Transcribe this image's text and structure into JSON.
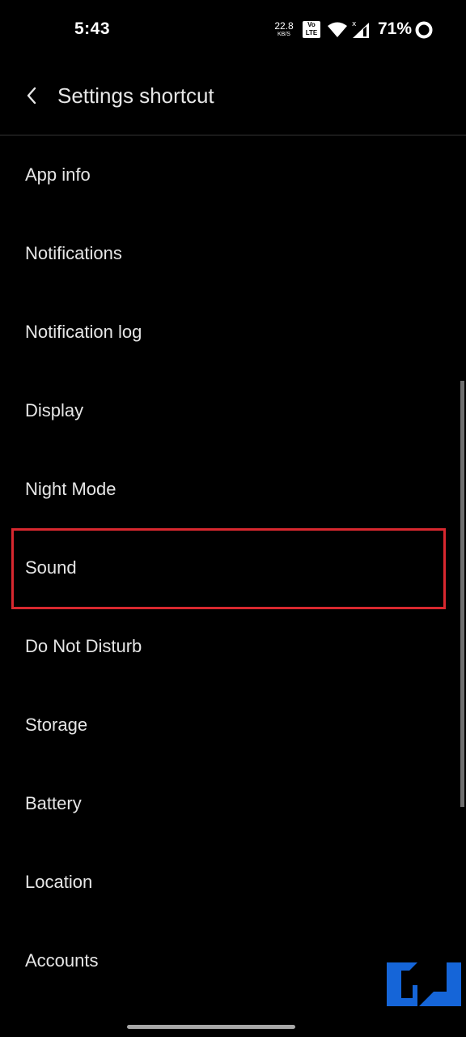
{
  "status_bar": {
    "time": "5:43",
    "net_speed_value": "22.8",
    "net_speed_unit": "KB/S",
    "volte_top": "Vo",
    "volte_bottom": "LTE",
    "battery_percent": "71%",
    "icons": [
      "volte-icon",
      "wifi-icon",
      "cell-signal-icon",
      "battery-ring-icon"
    ]
  },
  "app_bar": {
    "back_icon": "chevron-left-icon",
    "title": "Settings shortcut"
  },
  "list": {
    "items": [
      {
        "label": "App info"
      },
      {
        "label": "Notifications"
      },
      {
        "label": "Notification log"
      },
      {
        "label": "Display"
      },
      {
        "label": "Night Mode"
      },
      {
        "label": "Sound"
      },
      {
        "label": "Do Not Disturb"
      },
      {
        "label": "Storage"
      },
      {
        "label": "Battery"
      },
      {
        "label": "Location"
      },
      {
        "label": "Accounts"
      }
    ],
    "highlighted_item": "Sound",
    "highlight_color": "#d8282f"
  },
  "watermark": {
    "icon": "gadgets-to-use-logo-icon",
    "color": "#1565d8"
  }
}
